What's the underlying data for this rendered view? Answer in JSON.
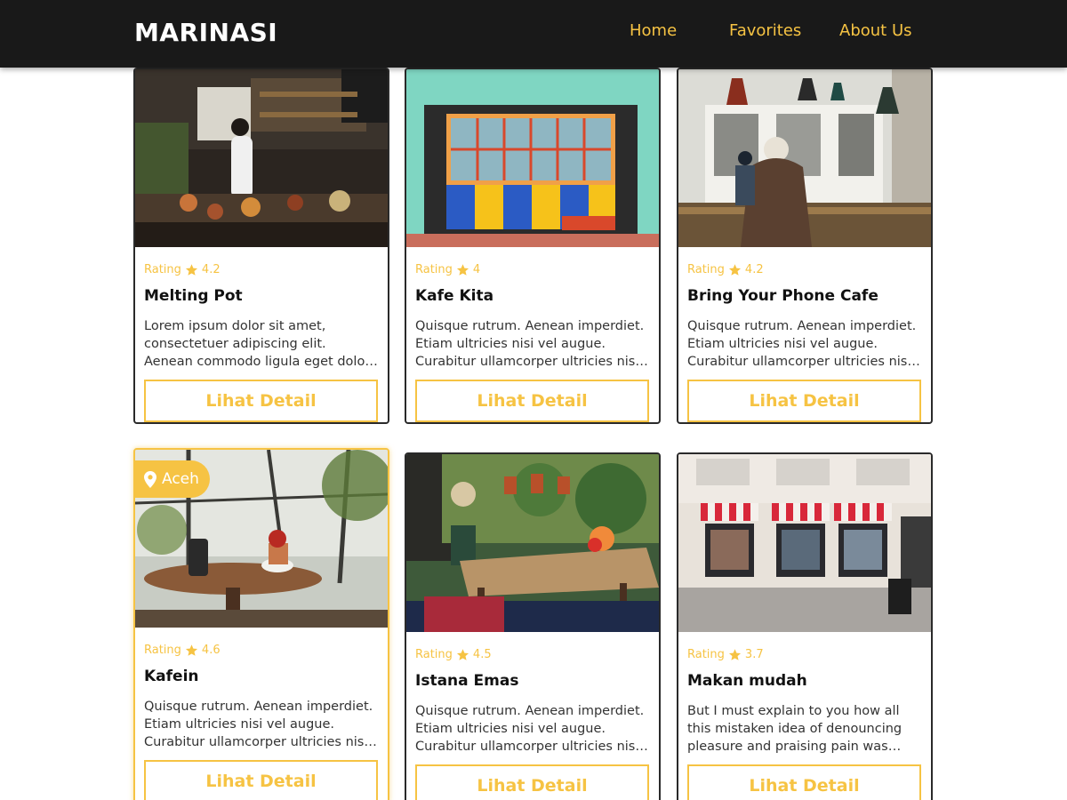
{
  "navbar": {
    "brand": "MARINASI",
    "links": [
      "Home",
      "Favorites",
      "About Us"
    ]
  },
  "colors": {
    "accent": "#f6c343",
    "navbar_bg": "#191919",
    "card_border": "#2a2a2a"
  },
  "rating_label": "Rating",
  "button_label": "Lihat Detail",
  "cards": [
    {
      "name": "Melting Pot",
      "rating": "4.2",
      "description": "Lorem ipsum dolor sit amet, consectetuer adipiscing elit. Aenean commodo ligula eget dolor. Aenean massa.",
      "image": "cafe-kitchen-photo"
    },
    {
      "name": "Kafe Kita",
      "rating": "4",
      "description": "Quisque rutrum. Aenean imperdiet. Etiam ultricies nisi vel augue. Curabitur ullamcorper ultricies nisi. Nam eget dui.",
      "image": "colorful-storefront-photo"
    },
    {
      "name": "Bring Your Phone Cafe",
      "rating": "4.2",
      "description": "Quisque rutrum. Aenean imperdiet. Etiam ultricies nisi vel augue. Curabitur ullamcorper ultricies nisi. Nam eget dui.",
      "image": "cafe-interior-photo"
    },
    {
      "name": "Kafein",
      "rating": "4.6",
      "location": "Aceh",
      "description": "Quisque rutrum. Aenean imperdiet. Etiam ultricies nisi vel augue. Curabitur ullamcorper ultricies nisi. Nam eget dui.",
      "image": "greenhouse-table-photo"
    },
    {
      "name": "Istana Emas",
      "rating": "4.5",
      "description": "Quisque rutrum. Aenean imperdiet. Etiam ultricies nisi vel augue. Curabitur ullamcorper ultricies nisi. Nam eget dui.",
      "image": "garden-cafe-photo"
    },
    {
      "name": "Makan mudah",
      "rating": "3.7",
      "description": "But I must explain to you how all this mistaken idea of denouncing pleasure and praising pain was born.",
      "image": "striped-awning-storefront-photo"
    }
  ]
}
